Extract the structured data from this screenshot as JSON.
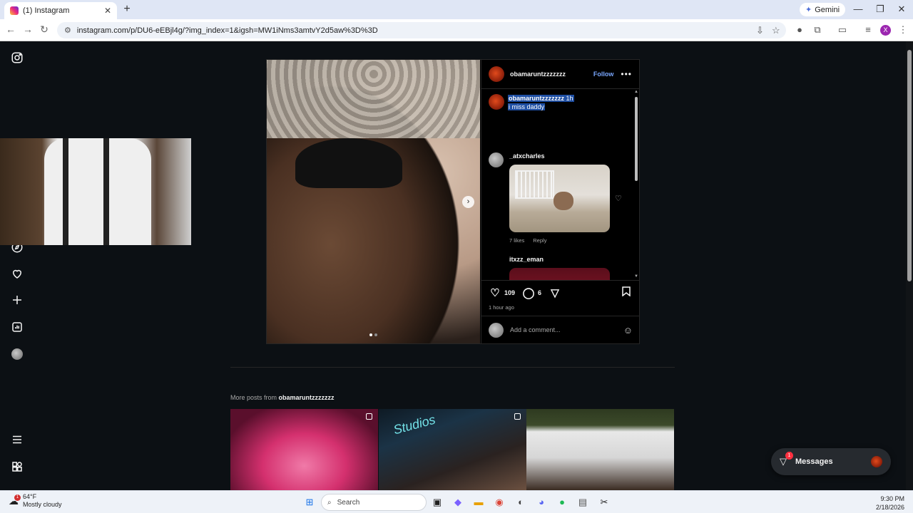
{
  "browser": {
    "tab_title": "(1) Instagram",
    "tab_close": "✕",
    "new_tab": "+",
    "gemini_label": "Gemini",
    "url": "instagram.com/p/DU6-eEBjl4g/?img_index=1&igsh=MW1iNms3amtvY2d5aw%3D%3D",
    "profile_initial": "X"
  },
  "post": {
    "author": "obamaruntzzzzzzz",
    "follow_label": "Follow",
    "caption_author": "obamaruntzzzzzzz",
    "caption_age": "1h",
    "caption_text": "i miss daddy",
    "likes": "109",
    "comments_count": "6",
    "time_ago": "1 hour ago",
    "add_comment_placeholder": "Add a comment...",
    "comments": [
      {
        "user": "_atxcharles",
        "likes": "7 likes",
        "reply": "Reply"
      },
      {
        "user": "itxzz_eman"
      }
    ]
  },
  "more_posts": {
    "prefix": "More posts from ",
    "user": "obamaruntzzzzzzz"
  },
  "messages": {
    "label": "Messages",
    "badge": "1"
  },
  "taskbar": {
    "temp": "64°F",
    "condition": "Mostly cloudy",
    "weather_badge": "1",
    "search_label": "Search",
    "time": "9:30 PM",
    "date": "2/18/2026"
  },
  "colors": {
    "ig_background": "#0c1014",
    "follow_blue": "#7aa7ff",
    "selection": "#1f4fa3",
    "notification_red": "#ff3040"
  },
  "icons": {
    "sidebar": [
      "instagram-icon",
      "explore-icon",
      "heart-icon",
      "create-icon",
      "dashboard-icon",
      "profile-avatar",
      "menu-icon",
      "apps-icon"
    ]
  }
}
